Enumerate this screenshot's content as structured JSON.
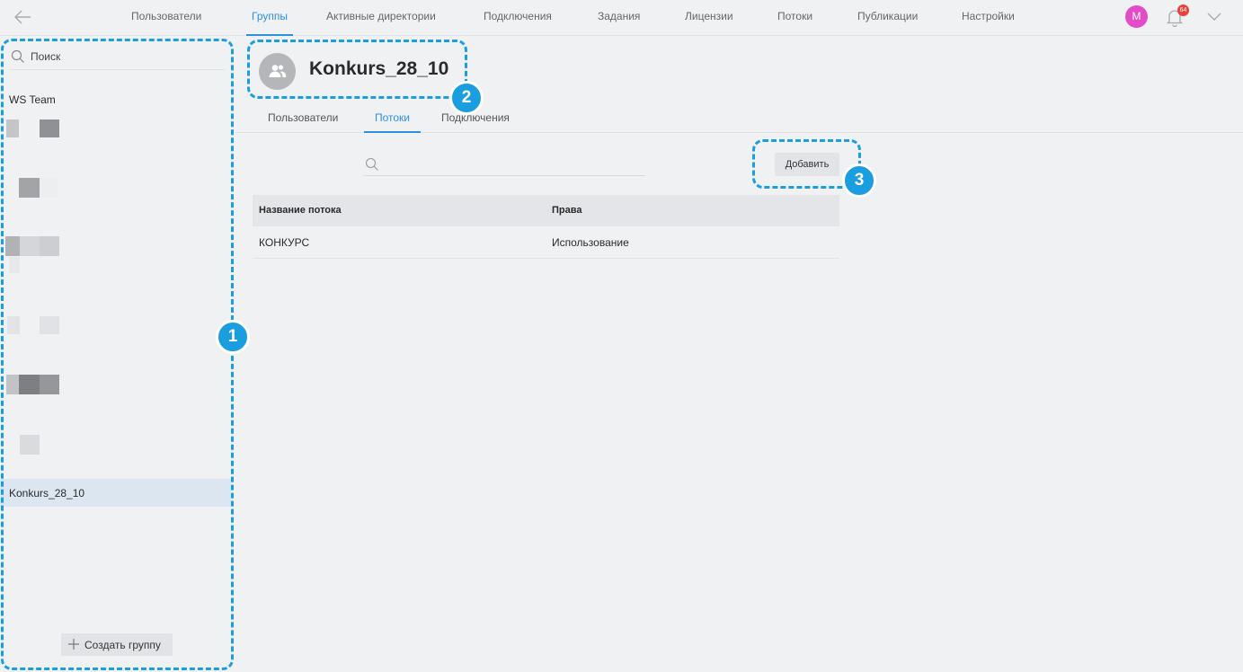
{
  "topnav": {
    "items": [
      {
        "label": "Пользователи"
      },
      {
        "label": "Группы"
      },
      {
        "label": "Активные директории"
      },
      {
        "label": "Подключения"
      },
      {
        "label": "Задания"
      },
      {
        "label": "Лицензии"
      },
      {
        "label": "Потоки"
      },
      {
        "label": "Публикации"
      },
      {
        "label": "Настройки"
      }
    ],
    "active": "Группы",
    "user_initial": "M",
    "notification_count": "64",
    "accent_color": "#2d8fe0"
  },
  "sidebar": {
    "search_placeholder": "Поиск",
    "groups": [
      {
        "label": "WS Team"
      },
      {
        "label": "Konkurs_28_10"
      }
    ],
    "selected": "Konkurs_28_10",
    "create_label": "Создать группу"
  },
  "group": {
    "name": "Konkurs_28_10",
    "tabs": [
      {
        "label": "Пользователи"
      },
      {
        "label": "Потоки"
      },
      {
        "label": "Подключения"
      }
    ],
    "active_tab": "Потоки",
    "add_label": "Добавить",
    "table": {
      "headers": [
        "Название потока",
        "Права"
      ],
      "rows": [
        [
          "КОНКУРС",
          "Использование"
        ]
      ]
    }
  },
  "annotations": {
    "markers": [
      "1",
      "2",
      "3"
    ],
    "color": "#1a9ee0"
  }
}
